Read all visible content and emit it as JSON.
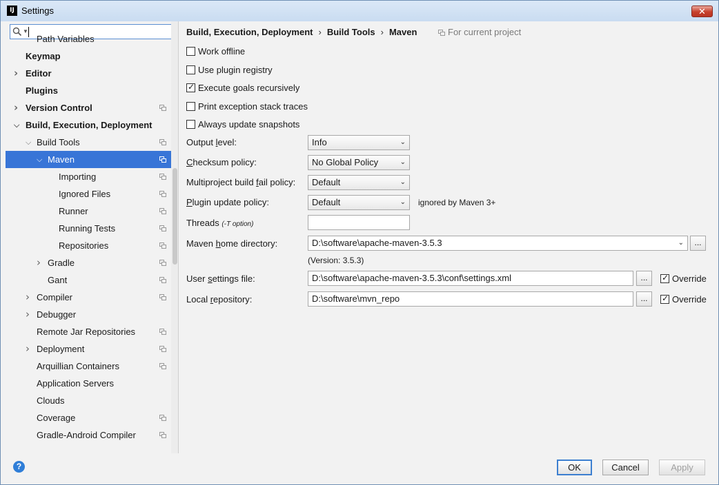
{
  "window": {
    "title": "Settings",
    "app_icon_text": "IJ"
  },
  "search": {
    "value": ""
  },
  "tree": [
    {
      "label": "Path Variables",
      "level": 2,
      "bold": false,
      "arrow": "",
      "shared": false,
      "selected": false
    },
    {
      "label": "Keymap",
      "level": 1,
      "bold": true,
      "arrow": "",
      "shared": false,
      "selected": false
    },
    {
      "label": "Editor",
      "level": 1,
      "bold": true,
      "arrow": ">",
      "shared": false,
      "selected": false
    },
    {
      "label": "Plugins",
      "level": 1,
      "bold": true,
      "arrow": "",
      "shared": false,
      "selected": false
    },
    {
      "label": "Version Control",
      "level": 1,
      "bold": true,
      "arrow": ">",
      "shared": true,
      "selected": false
    },
    {
      "label": "Build, Execution, Deployment",
      "level": 1,
      "bold": true,
      "arrow": "v",
      "shared": false,
      "selected": false
    },
    {
      "label": "Build Tools",
      "level": 2,
      "bold": false,
      "arrow": "v",
      "shared": true,
      "selected": false
    },
    {
      "label": "Maven",
      "level": 3,
      "bold": false,
      "arrow": "v",
      "shared": true,
      "selected": true
    },
    {
      "label": "Importing",
      "level": 4,
      "bold": false,
      "arrow": "",
      "shared": true,
      "selected": false
    },
    {
      "label": "Ignored Files",
      "level": 4,
      "bold": false,
      "arrow": "",
      "shared": true,
      "selected": false
    },
    {
      "label": "Runner",
      "level": 4,
      "bold": false,
      "arrow": "",
      "shared": true,
      "selected": false
    },
    {
      "label": "Running Tests",
      "level": 4,
      "bold": false,
      "arrow": "",
      "shared": true,
      "selected": false
    },
    {
      "label": "Repositories",
      "level": 4,
      "bold": false,
      "arrow": "",
      "shared": true,
      "selected": false
    },
    {
      "label": "Gradle",
      "level": 3,
      "bold": false,
      "arrow": ">",
      "shared": true,
      "selected": false
    },
    {
      "label": "Gant",
      "level": 3,
      "bold": false,
      "arrow": "",
      "shared": true,
      "selected": false
    },
    {
      "label": "Compiler",
      "level": 2,
      "bold": false,
      "arrow": ">",
      "shared": true,
      "selected": false
    },
    {
      "label": "Debugger",
      "level": 2,
      "bold": false,
      "arrow": ">",
      "shared": false,
      "selected": false
    },
    {
      "label": "Remote Jar Repositories",
      "level": 2,
      "bold": false,
      "arrow": "",
      "shared": true,
      "selected": false
    },
    {
      "label": "Deployment",
      "level": 2,
      "bold": false,
      "arrow": ">",
      "shared": true,
      "selected": false
    },
    {
      "label": "Arquillian Containers",
      "level": 2,
      "bold": false,
      "arrow": "",
      "shared": true,
      "selected": false
    },
    {
      "label": "Application Servers",
      "level": 2,
      "bold": false,
      "arrow": "",
      "shared": false,
      "selected": false
    },
    {
      "label": "Clouds",
      "level": 2,
      "bold": false,
      "arrow": "",
      "shared": false,
      "selected": false
    },
    {
      "label": "Coverage",
      "level": 2,
      "bold": false,
      "arrow": "",
      "shared": true,
      "selected": false
    },
    {
      "label": "Gradle-Android Compiler",
      "level": 2,
      "bold": false,
      "arrow": "",
      "shared": true,
      "selected": false
    }
  ],
  "breadcrumb": {
    "part1": "Build, Execution, Deployment",
    "sep": "›",
    "part2": "Build Tools",
    "part3": "Maven"
  },
  "for_project": "For current project",
  "checkboxes": [
    {
      "label": "Work offline",
      "checked": false
    },
    {
      "label": "Use plugin registry",
      "checked": false
    },
    {
      "label": "Execute goals recursively",
      "checked": true
    },
    {
      "label": "Print exception stack traces",
      "checked": false
    },
    {
      "label": "Always update snapshots",
      "checked": false
    }
  ],
  "output_level": {
    "label": "Output level:",
    "value": "Info"
  },
  "checksum_policy": {
    "label": "Checksum policy:",
    "value": "No Global Policy"
  },
  "fail_policy": {
    "label": "Multiproject build fail policy:",
    "value": "Default"
  },
  "plugin_update_policy": {
    "label": "Plugin update policy:",
    "value": "Default",
    "note": "ignored by Maven 3+"
  },
  "threads": {
    "label": "Threads",
    "hint": "(-T option)",
    "value": ""
  },
  "maven_home": {
    "label": "Maven home directory:",
    "value": "D:\\software\\apache-maven-3.5.3",
    "version": "(Version: 3.5.3)",
    "browse": "..."
  },
  "user_settings": {
    "label": "User settings file:",
    "value": "D:\\software\\apache-maven-3.5.3\\conf\\settings.xml",
    "browse": "...",
    "override_label": "Override",
    "override_checked": true
  },
  "local_repo": {
    "label": "Local repository:",
    "value": "D:\\software\\mvn_repo",
    "browse": "...",
    "override_label": "Override",
    "override_checked": true
  },
  "footer": {
    "help": "?",
    "ok": "OK",
    "cancel": "Cancel",
    "apply": "Apply"
  }
}
